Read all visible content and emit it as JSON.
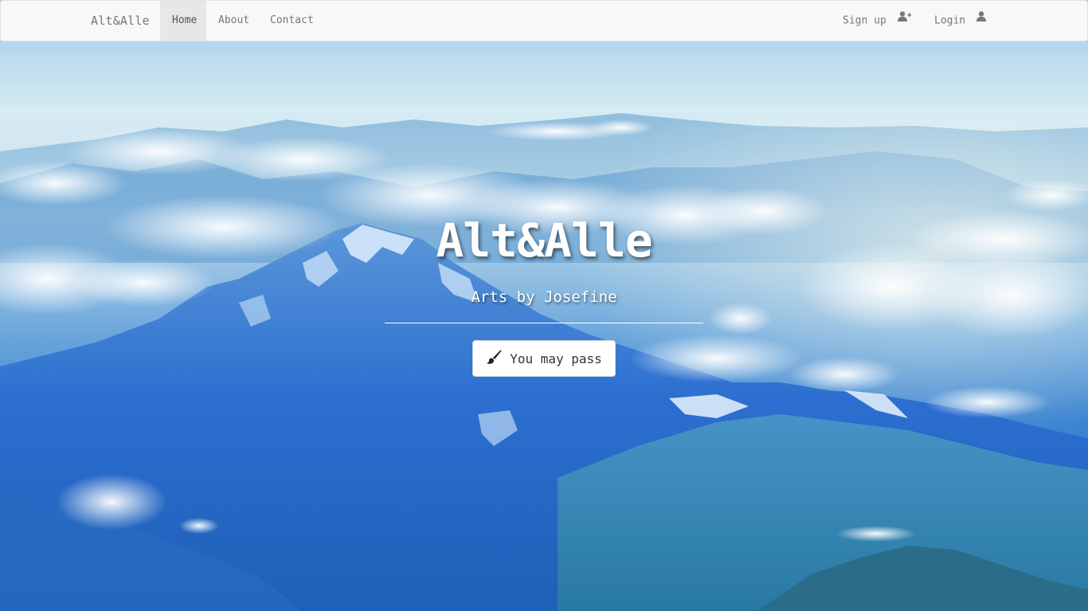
{
  "navbar": {
    "brand": "Alt&Alle",
    "items": [
      {
        "label": "Home",
        "active": true
      },
      {
        "label": "About",
        "active": false
      },
      {
        "label": "Contact",
        "active": false
      }
    ],
    "right_items": [
      {
        "label": "Sign up",
        "icon": "user-plus-icon"
      },
      {
        "label": "Login",
        "icon": "user-icon"
      }
    ]
  },
  "hero": {
    "title": "Alt&Alle",
    "subtitle": "Arts by Josefine",
    "cta_label": "You may pass",
    "cta_icon": "paint-brush-icon",
    "background": "mountain-clouds-photo"
  },
  "colors": {
    "navbar_bg": "#f8f8f8",
    "active_item_bg": "#e7e7e7",
    "nav_text": "#777777",
    "hero_text": "#ffffff"
  }
}
